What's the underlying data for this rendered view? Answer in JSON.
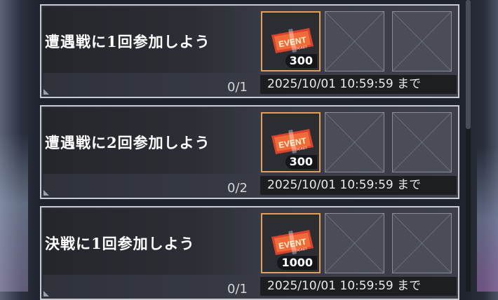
{
  "missions": [
    {
      "title": "遭遇戦に1回参加しよう",
      "reward_count": "300",
      "progress": "0/1",
      "deadline": "2025/10/01 10:59:59 まで"
    },
    {
      "title": "遭遇戦に2回参加しよう",
      "reward_count": "300",
      "progress": "0/2",
      "deadline": "2025/10/01 10:59:59 まで"
    },
    {
      "title": "決戦に1回参加しよう",
      "reward_count": "1000",
      "progress": "0/1",
      "deadline": "2025/10/01 10:59:59 まで"
    }
  ],
  "reward_icon": {
    "name": "event-ticket-icon",
    "label": "EVENT",
    "sublabel": "TICKET"
  },
  "colors": {
    "reward_border": "#e0a05a",
    "card_border": "#c7cad1",
    "ticket_red": "#d8432e"
  }
}
